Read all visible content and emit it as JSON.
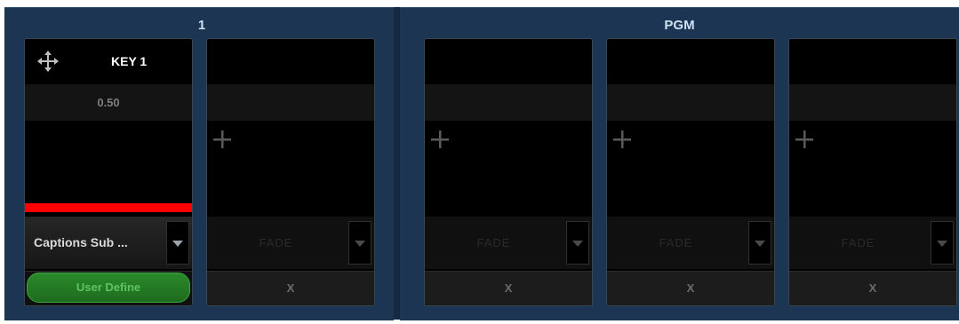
{
  "groups": [
    {
      "title": "1"
    },
    {
      "title": "PGM"
    }
  ],
  "slot1": {
    "key_label": "KEY 1",
    "value": "0.50",
    "source_select": "Captions Sub ...",
    "mode_button": "User Define",
    "indicator_color": "#ff0000",
    "accent_color": "#2a8a2a"
  },
  "empty_slots": {
    "transition": "FADE",
    "remove": "X"
  },
  "icons": {
    "move": "move-arrows-icon",
    "add": "plus-icon",
    "dropdown": "chevron-down-icon"
  }
}
